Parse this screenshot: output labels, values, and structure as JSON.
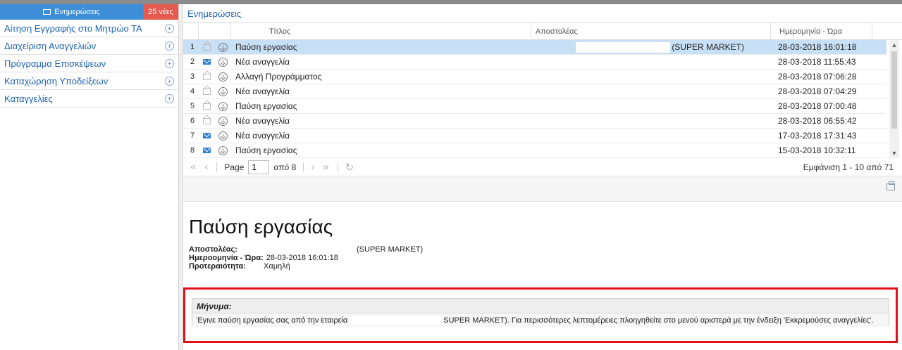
{
  "sidebar": {
    "tab_label": "Ενημερώσεις",
    "badge": "25 νέες",
    "items": [
      {
        "label": "Αίτηση Εγγραφής στο Μητρώο ΤΑ"
      },
      {
        "label": "Διαχείριση Αναγγελιών"
      },
      {
        "label": "Πρόγραμμα Επισκέψεων"
      },
      {
        "label": "Καταχώρηση Υποδείξεων"
      },
      {
        "label": "Καταγγελίες"
      }
    ]
  },
  "panel": {
    "title": "Ενημερώσεις"
  },
  "grid": {
    "columns": {
      "title": "Τίτλος",
      "sender": "Αποστολέας",
      "date": "Ημερομηνία - Ώρα"
    },
    "rows": [
      {
        "num": "1",
        "read": true,
        "title": "Παύση εργασίας",
        "sender": "(SUPER MARKET)",
        "date": "28-03-2018 16:01:18",
        "selected": true
      },
      {
        "num": "2",
        "read": false,
        "title": "Νέα αναγγελία",
        "sender": "",
        "date": "28-03-2018 11:55:43"
      },
      {
        "num": "3",
        "read": true,
        "title": "Αλλαγή Προγράμματος",
        "sender": "",
        "date": "28-03-2018 07:06:28"
      },
      {
        "num": "4",
        "read": true,
        "title": "Νέα αναγγελία",
        "sender": "",
        "date": "28-03-2018 07:04:29"
      },
      {
        "num": "5",
        "read": true,
        "title": "Παύση εργασίας",
        "sender": "",
        "date": "28-03-2018 07:00:48"
      },
      {
        "num": "6",
        "read": true,
        "title": "Νέα αναγγελία",
        "sender": "",
        "date": "28-03-2018 06:55:42"
      },
      {
        "num": "7",
        "read": false,
        "title": "Νέα αναγγελία",
        "sender": "",
        "date": "17-03-2018 17:31:43"
      },
      {
        "num": "8",
        "read": false,
        "title": "Παύση εργασίας",
        "sender": "",
        "date": "15-03-2018 10:32:11"
      }
    ]
  },
  "pager": {
    "page_label": "Page",
    "page_value": "1",
    "of_label": "από 8",
    "display_info": "Εμφάνιση 1 - 10 από 71"
  },
  "detail": {
    "title": "Παύση εργασίας",
    "sender_label": "Αποστολέας:",
    "sender_value": "(SUPER MARKET)",
    "date_label": "Ημεροομηνία - Ώρα:",
    "date_value": "28-03-2018 16:01:18",
    "priority_label": "Προτεραιότητα:",
    "priority_value": "Χαμηλή",
    "message_label": "Μήνυμα:",
    "message_text_a": "Έγινε παύση εργασίας σας από την εταιρεία",
    "message_text_b": "SUPER MARKET). Για περισσότερες λεπτομέρειες πλοηγηθείτε στο μενού αριστερά με την ένδειξη 'Εκκρεμούσες αναγγελίες'."
  }
}
